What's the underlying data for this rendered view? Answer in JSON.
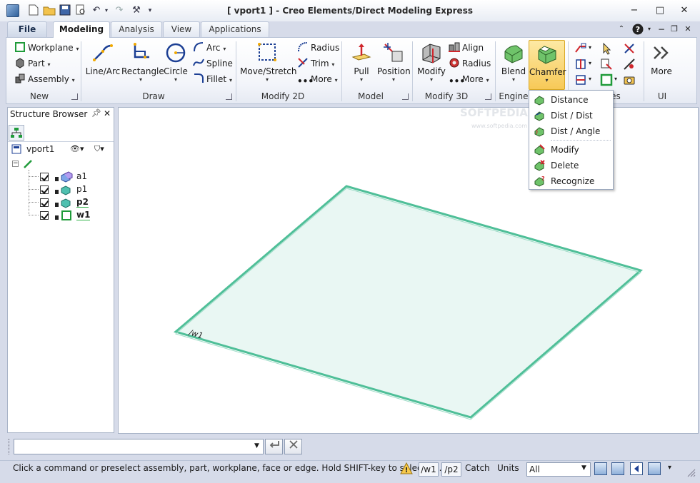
{
  "window": {
    "title": "[ vport1 ] - Creo Elements/Direct Modeling Express",
    "controls": {
      "minimize": "−",
      "restore": "□",
      "close": "✕"
    }
  },
  "tabs": [
    {
      "label": "File"
    },
    {
      "label": "Modeling"
    },
    {
      "label": "Analysis"
    },
    {
      "label": "View"
    },
    {
      "label": "Applications"
    }
  ],
  "ribbon": {
    "groups": {
      "new": "New",
      "draw": "Draw",
      "modify2d": "Modify 2D",
      "model": "Model",
      "modify3d": "Modify 3D",
      "engineering": "Engine",
      "faces": "es",
      "ui": "UI"
    },
    "new": {
      "workplane": "Workplane",
      "part": "Part",
      "assembly": "Assembly"
    },
    "draw": {
      "linearc": "Line/Arc",
      "rectangle": "Rectangle",
      "circle": "Circle",
      "arc": "Arc",
      "spline": "Spline",
      "fillet": "Fillet"
    },
    "modify2d": {
      "movestretch": "Move/Stretch",
      "radius": "Radius",
      "trim": "Trim",
      "more": "More"
    },
    "model": {
      "pull": "Pull",
      "position": "Position"
    },
    "modify3d": {
      "modify": "Modify",
      "align": "Align",
      "radius": "Radius",
      "more": "More"
    },
    "engineering": {
      "blend": "Blend",
      "chamfer": "Chamfer"
    },
    "ui": {
      "more": "More"
    }
  },
  "chamfer_menu": {
    "items": [
      "Distance",
      "Dist / Dist",
      "Dist / Angle",
      "Modify",
      "Delete",
      "Recognize"
    ]
  },
  "structure_browser": {
    "title": "Structure Browser",
    "root": "vport1",
    "items": [
      "a1",
      "p1",
      "p2",
      "w1"
    ]
  },
  "viewport": {
    "workplane_label": "/w1",
    "watermark": "SOFTPEDIA",
    "watermark_url": "www.softpedia.com"
  },
  "statusbar": {
    "message": "Click a command or preselect assembly, part, workplane, face or edge. Hold SHIFT-key to select m...",
    "workplane": "/w1",
    "part": "/p2",
    "catch": "Catch",
    "units": "Units",
    "select_value": "All"
  },
  "colors": {
    "accent": "#f7c957",
    "workplane_fill": "#e9f7f3",
    "workplane_edge": "#4fbf98"
  }
}
